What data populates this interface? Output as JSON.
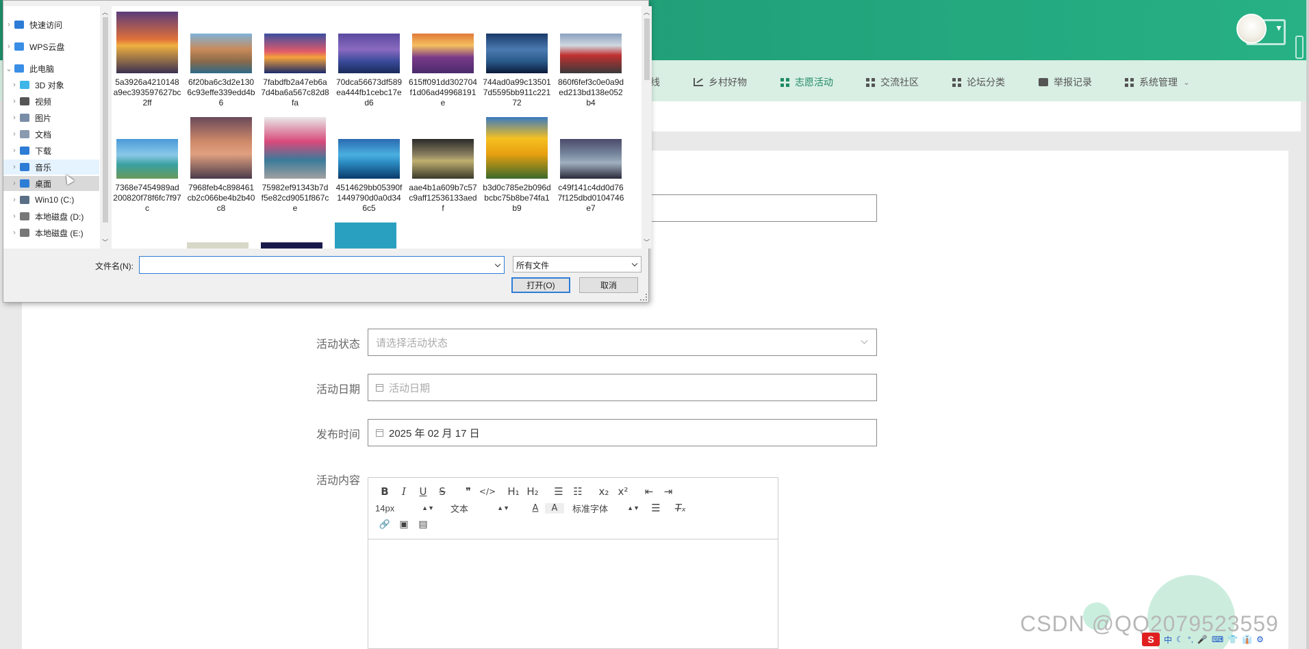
{
  "nav": {
    "items": [
      {
        "label": "线",
        "icon": "none"
      },
      {
        "label": "乡村好物",
        "icon": "chart-icon"
      },
      {
        "label": "志愿活动",
        "icon": "grid-icon",
        "active": true
      },
      {
        "label": "交流社区",
        "icon": "grid-icon"
      },
      {
        "label": "论坛分类",
        "icon": "grid-icon"
      },
      {
        "label": "举报记录",
        "icon": "print-icon"
      },
      {
        "label": "系统管理",
        "icon": "grid-icon",
        "dropdown": "⌄"
      }
    ]
  },
  "form": {
    "status_label": "活动状态",
    "status_placeholder": "请选择活动状态",
    "date_label": "活动日期",
    "date_placeholder": "活动日期",
    "publish_label": "发布时间",
    "publish_value": "2025 年 02 月 17 日",
    "content_label": "活动内容"
  },
  "editor": {
    "row1": [
      "B",
      "I",
      "U",
      "S",
      "❞",
      "</>",
      "H₁",
      "H₂",
      "☰",
      "☷",
      "x₂",
      "x²",
      "⇤",
      "⇥"
    ],
    "font_size": "14px",
    "text_type": "文本",
    "font_family": "标准字体",
    "row3": [
      "🔗",
      "▣",
      "▤"
    ]
  },
  "dialog": {
    "tree": [
      {
        "label": "快速访问",
        "icon": "star-icon",
        "color": "#2d7cd6"
      },
      {
        "label": "WPS云盘",
        "icon": "cloud-icon",
        "color": "#3a8ee6"
      },
      {
        "label": "此电脑",
        "icon": "computer-icon",
        "color": "#3a8ee6"
      },
      {
        "label": "3D 对象",
        "icon": "cube-icon",
        "color": "#3fb6e8"
      },
      {
        "label": "视频",
        "icon": "video-icon",
        "color": "#555"
      },
      {
        "label": "图片",
        "icon": "picture-icon",
        "color": "#7a8da8"
      },
      {
        "label": "文档",
        "icon": "document-icon",
        "color": "#8a9ab0"
      },
      {
        "label": "下载",
        "icon": "download-icon",
        "color": "#2d7cd6"
      },
      {
        "label": "音乐",
        "icon": "music-icon",
        "color": "#2d7cd6"
      },
      {
        "label": "桌面",
        "icon": "desktop-icon",
        "color": "#2d7cd6"
      },
      {
        "label": "Win10 (C:)",
        "icon": "drive-icon",
        "color": "#5a6f85"
      },
      {
        "label": "本地磁盘 (D:)",
        "icon": "drive-icon",
        "color": "#777"
      },
      {
        "label": "本地磁盘 (E:)",
        "icon": "drive-icon",
        "color": "#777"
      }
    ],
    "files": [
      {
        "name": "5a3926a4210148a9ec393597627bc2ff"
      },
      {
        "name": "6f20ba6c3d2e1306c93effe339edd4b6"
      },
      {
        "name": "7fabdfb2a47eb6a7d4ba6a567c82d8fa"
      },
      {
        "name": "70dca56673df589ea444fb1cebc17ed6"
      },
      {
        "name": "615ff091dd302704f1d06ad49968191e"
      },
      {
        "name": "744ad0a99c135017d5595bb911c22172"
      },
      {
        "name": "860f6fef3c0e0a9ded213bd138e052b4"
      },
      {
        "name": "7368e7454989ad200820f78f6fc7f97c"
      },
      {
        "name": "7968feb4c898461cb2c066be4b2b40c8"
      },
      {
        "name": "75982ef91343b7df5e82cd9051f867ce"
      },
      {
        "name": "4514629bb05390f1449790d0a0d346c5"
      },
      {
        "name": "aae4b1a609b7c57c9aff12536133aedf"
      },
      {
        "name": "b3d0c785e2b096dbcbc75b8be74fa1b9"
      },
      {
        "name": "c49f141c4dd0d767f125dbd0104746e7"
      }
    ],
    "filename_label": "文件名(N):",
    "filename_value": "",
    "filetype_value": "所有文件",
    "open_label": "打开(O)",
    "cancel_label": "取消"
  },
  "watermark": "CSDN @QQ2079523559",
  "ime": {
    "logo": "S",
    "items": [
      "中",
      "☾",
      "°,",
      "🎤",
      "⌨",
      "👕",
      "👔",
      "⚙"
    ]
  },
  "colors": {
    "header": "#22a37b",
    "nav_bg": "#d9efe4",
    "accent": "#1f8a66",
    "dialog_focus": "#2d7cd6"
  }
}
